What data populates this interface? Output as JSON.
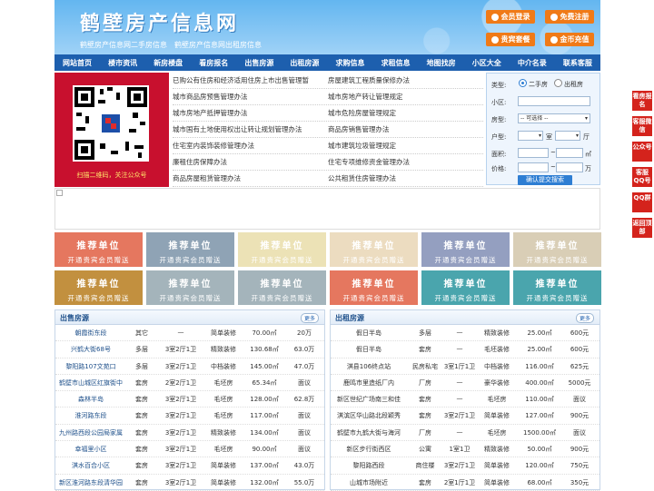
{
  "header": {
    "title": "鹤壁房产信息网",
    "sub": [
      "鹤壁房产信息网二手房信息",
      "鹤壁房产信息网出租房信息"
    ],
    "buttons": [
      "会员登录",
      "免费注册",
      "贵宾套餐",
      "金币充值"
    ]
  },
  "nav": [
    "网站首页",
    "楼市资讯",
    "新房楼盘",
    "看房报名",
    "出售房源",
    "出租房源",
    "求购信息",
    "求租信息",
    "地图找房",
    "小区大全",
    "中介名录",
    "联系客服"
  ],
  "qr": {
    "caption": "扫描二维码，关注公众号"
  },
  "links": [
    [
      "已购公有住房和经济适用住房上市出售管理暂",
      "房屋建筑工程质量保修办法"
    ],
    [
      "城市商品房预售管理办法",
      "城市房地产转让管理规定"
    ],
    [
      "城市房地产抵押管理办法",
      "城市危险房屋管理规定"
    ],
    [
      "城市国有土地使用权出让转让规划管理办法",
      "商品房销售管理办法"
    ],
    [
      "住宅室内装饰装修管理办法",
      "城市建筑垃圾管理规定"
    ],
    [
      "廉租住房保障办法",
      "住宅专项维修资金管理办法"
    ],
    [
      "商品房屋租赁管理办法",
      "公共租赁住房管理办法"
    ]
  ],
  "search": {
    "type_label": "类型:",
    "opt1": "二手房",
    "opt2": "出租房",
    "area_label": "小区:",
    "kind_label": "房型:",
    "kind_value": "-- 可选择 --",
    "layout_label": "户型:",
    "room": "室",
    "hall": "厅",
    "size_label": "面积:",
    "size_unit": "㎡",
    "price_label": "价格:",
    "price_unit": "万",
    "submit": "确认提交搜索"
  },
  "tiles": {
    "line1": "推荐单位",
    "line2": "开通贵宾会员赠送",
    "colors": [
      "#e5775f",
      "#8fa3b5",
      "#ece2b6",
      "#ecdcc0",
      "#949fc0",
      "#d9ceb6",
      "#c2903f",
      "#a4b4bb",
      "#a4b4bb",
      "#e5775f",
      "#4aa5ad",
      "#4aa5ad"
    ]
  },
  "sale": {
    "title": "出售房源",
    "more": "更多",
    "rows": [
      [
        "朝霞街东段",
        "其它",
        "—",
        "简单装修",
        "70.00㎡",
        "20万"
      ],
      [
        "兴鹤大街68号",
        "多层",
        "3室2厅1卫",
        "精致装修",
        "130.68㎡",
        "63.0万"
      ],
      [
        "黎阳路107文苑口",
        "多层",
        "3室2厅1卫",
        "中档装修",
        "145.00㎡",
        "47.0万"
      ],
      [
        "鹤壁市山城区红旗街中",
        "套房",
        "2室2厅1卫",
        "毛坯房",
        "65.34㎡",
        "面议"
      ],
      [
        "森林半岛",
        "套房",
        "3室2厅1卫",
        "毛坯房",
        "128.00㎡",
        "62.8万"
      ],
      [
        "淮河路东段",
        "套房",
        "3室2厅1卫",
        "毛坯房",
        "117.00㎡",
        "面议"
      ],
      [
        "九州路西段公园局家属",
        "套房",
        "3室2厅1卫",
        "精致装修",
        "134.00㎡",
        "面议"
      ],
      [
        "幸福里小区",
        "套房",
        "3室2厅1卫",
        "毛坯房",
        "90.00㎡",
        "面议"
      ],
      [
        "淇水百合小区",
        "套房",
        "3室2厅1卫",
        "简单装修",
        "137.00㎡",
        "43.0万"
      ],
      [
        "新区淮河路东段清华园",
        "套房",
        "3室2厅1卫",
        "简单装修",
        "132.00㎡",
        "55.0万"
      ]
    ]
  },
  "rent": {
    "title": "出租房源",
    "more": "更多",
    "rows": [
      [
        "假日半岛",
        "多层",
        "—",
        "精致装修",
        "25.00㎡",
        "600元"
      ],
      [
        "假日半岛",
        "套房",
        "—",
        "毛坯装修",
        "25.00㎡",
        "600元"
      ],
      [
        "淇县106终点站",
        "民房私宅",
        "3室1厅1卫",
        "中档装修",
        "116.00㎡",
        "625元"
      ],
      [
        "鹿鸣市里造纸厂内",
        "厂房",
        "—",
        "豪华装修",
        "400.00㎡",
        "5000元"
      ],
      [
        "新区世纪广场南三和佳",
        "套房",
        "—",
        "毛坯房",
        "110.00㎡",
        "面议"
      ],
      [
        "淇滨区华山路北段颖秀",
        "套房",
        "3室2厅1卫",
        "简单装修",
        "127.00㎡",
        "900元"
      ],
      [
        "鹤壁市九鹤大街与海河",
        "厂房",
        "—",
        "毛坯房",
        "1500.00㎡",
        "面议"
      ],
      [
        "新区步行街西区",
        "公寓",
        "1室1卫",
        "精致装修",
        "50.00㎡",
        "900元"
      ],
      [
        "黎阳路西段",
        "商住楼",
        "3室2厅1卫",
        "简单装修",
        "120.00㎡",
        "750元"
      ],
      [
        "山城市场附近",
        "套房",
        "2室1厅1卫",
        "简单装修",
        "68.00㎡",
        "350元"
      ]
    ]
  },
  "side": [
    "看房报名",
    "客服微信",
    "公众号",
    "客服QQ号",
    "QQ群",
    "返回顶部"
  ]
}
